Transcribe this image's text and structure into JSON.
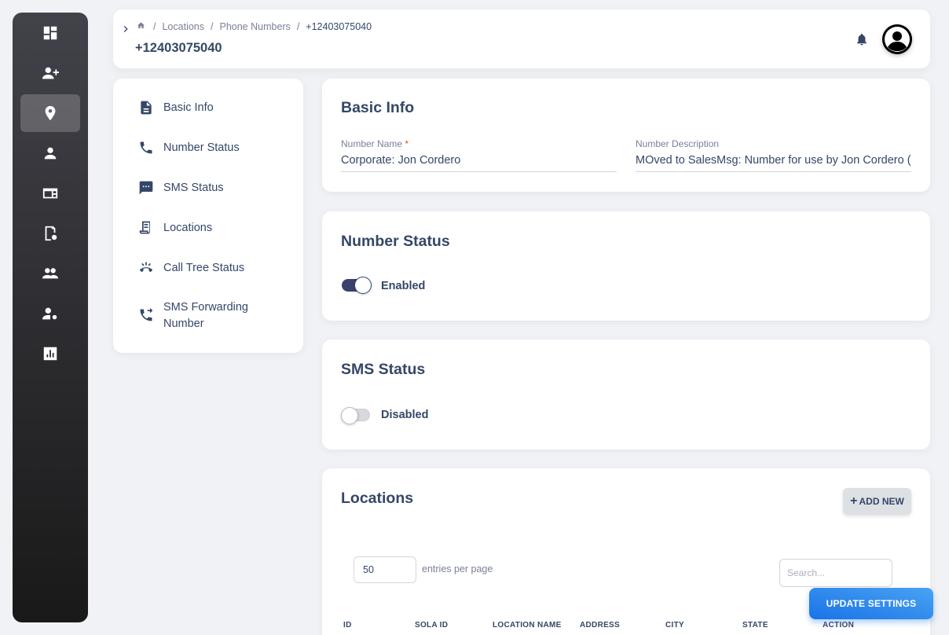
{
  "sidebar": {
    "items": [
      {
        "icon": "dashboard-icon"
      },
      {
        "icon": "add-user-icon"
      },
      {
        "icon": "location-pin-icon",
        "active": true
      },
      {
        "icon": "person-icon"
      },
      {
        "icon": "card-icon"
      },
      {
        "icon": "settings-document-icon"
      },
      {
        "icon": "group-icon"
      },
      {
        "icon": "user-settings-icon"
      },
      {
        "icon": "analytics-icon"
      }
    ]
  },
  "header": {
    "breadcrumb": [
      "Locations",
      "Phone Numbers",
      "+12403075040"
    ],
    "title": "+12403075040"
  },
  "nav": {
    "items": [
      {
        "label": "Basic Info",
        "icon": "document-icon"
      },
      {
        "label": "Number Status",
        "icon": "phone-icon"
      },
      {
        "label": "SMS Status",
        "icon": "sms-icon"
      },
      {
        "label": "Locations",
        "icon": "receipt-icon"
      },
      {
        "label": "Call Tree Status",
        "icon": "call-end-icon"
      },
      {
        "label": "SMS Forwarding Number",
        "icon": "phone-forward-icon"
      }
    ]
  },
  "basic_info": {
    "title": "Basic Info",
    "name_label": "Number Name",
    "name_required": "*",
    "name_value": "Corporate: Jon Cordero",
    "description_label": "Number Description",
    "description_value": "MOved to SalesMsg: Number for use by Jon Cordero (D"
  },
  "number_status": {
    "title": "Number Status",
    "enabled": true,
    "label": "Enabled"
  },
  "sms_status": {
    "title": "SMS Status",
    "enabled": false,
    "label": "Disabled"
  },
  "locations": {
    "title": "Locations",
    "add_label": "ADD NEW",
    "entries_value": "50",
    "entries_label": "entries per page",
    "search_placeholder": "Search...",
    "columns": [
      "ID",
      "SOLA ID",
      "LOCATION NAME",
      "ADDRESS",
      "CITY",
      "STATE",
      "ACTION"
    ]
  },
  "actions": {
    "update_label": "UPDATE SETTINGS"
  }
}
